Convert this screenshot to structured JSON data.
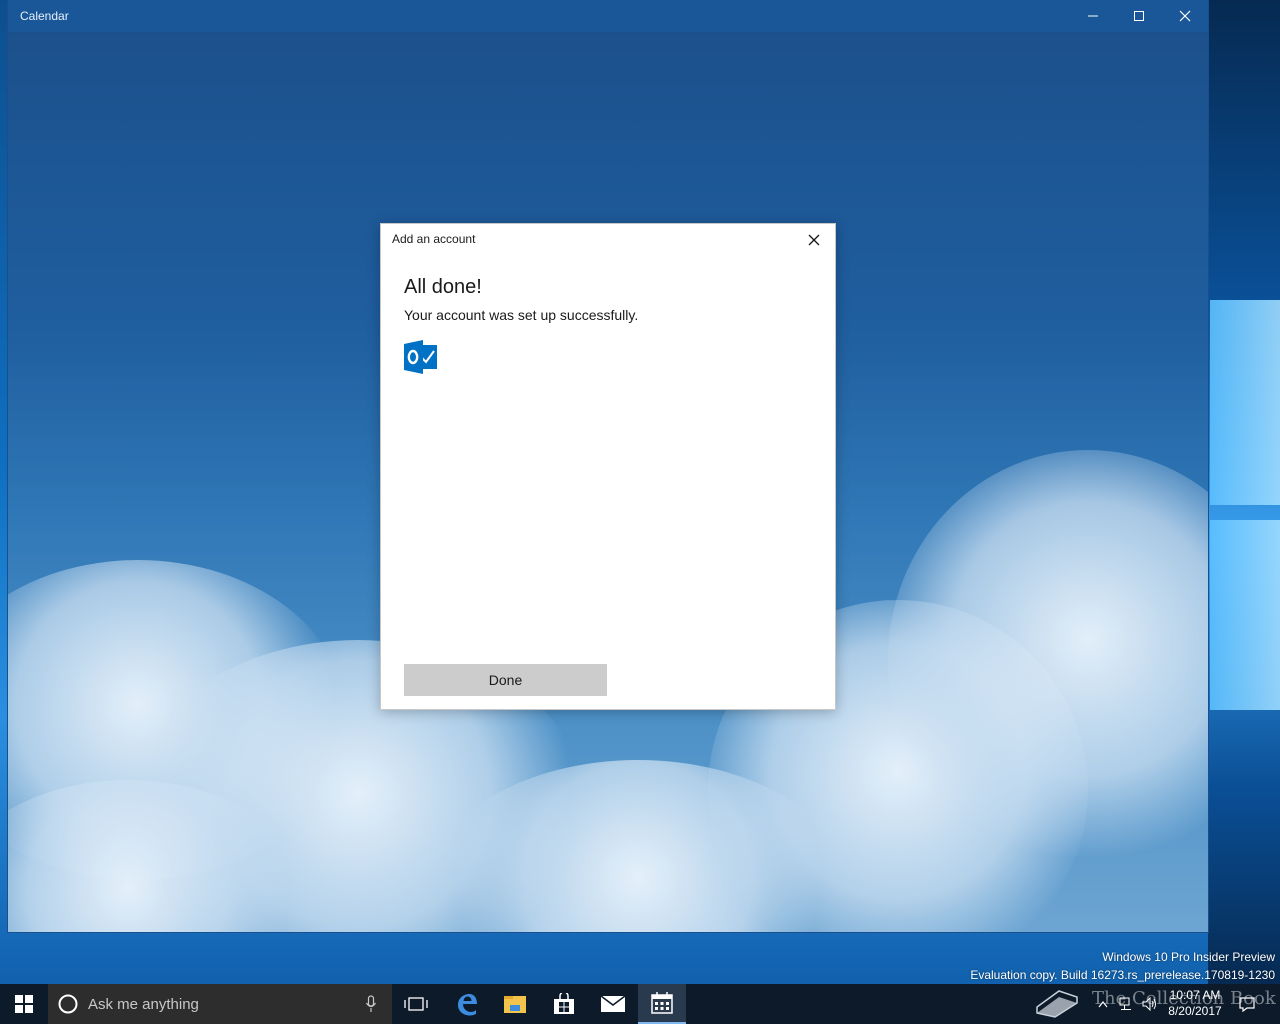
{
  "app": {
    "title": "Calendar",
    "controls": {
      "minimize": "minimize",
      "maximize": "maximize",
      "close": "close"
    }
  },
  "dialog": {
    "title": "Add an account",
    "heading": "All done!",
    "message": "Your account was set up successfully.",
    "account_icon": "outlook-icon",
    "done_label": "Done"
  },
  "watermark": {
    "line1": "Windows 10 Pro Insider Preview",
    "line2": "Evaluation copy. Build 16273.rs_prerelease.170819-1230"
  },
  "taskbar": {
    "search_placeholder": "Ask me anything",
    "pinned": [
      "task-view",
      "edge",
      "file-explorer",
      "store",
      "mail",
      "calendar"
    ],
    "active": "calendar",
    "clock_time": "10:07 AM",
    "clock_date": "8/20/2017",
    "overlay_text": "The Collection Book"
  },
  "colors": {
    "titlebar": "#1a5799",
    "taskbar": "#0c1a2a",
    "done_button": "#cccccc",
    "outlook_blue": "#0072c6"
  }
}
